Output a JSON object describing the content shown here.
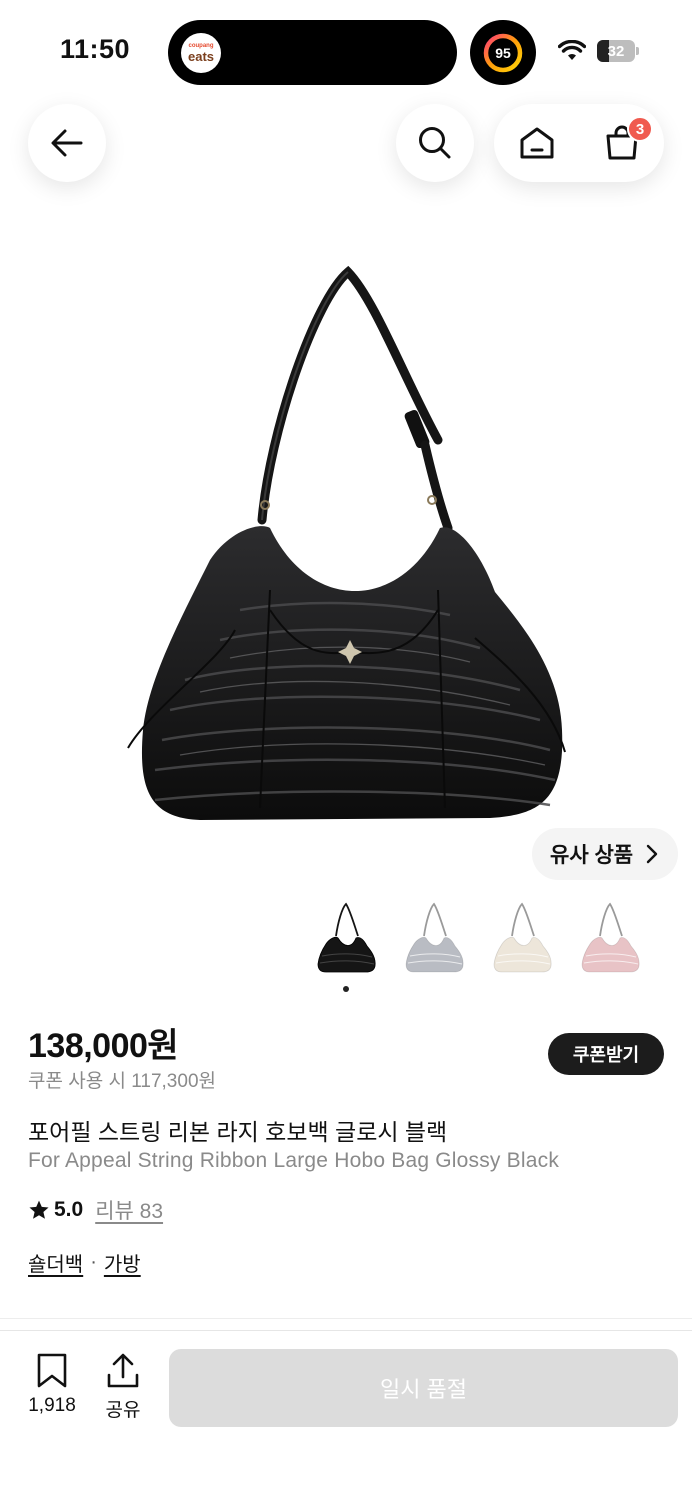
{
  "status_bar": {
    "time": "11:50",
    "live_activity_small": "coupang",
    "live_activity_big": "eats",
    "activity_ring_value": "95",
    "battery_level": 32,
    "battery_text": "32"
  },
  "nav": {
    "back_icon": "arrow-left-icon",
    "search_icon": "search-icon",
    "home_icon": "home-icon",
    "cart_icon": "shopping-bag-icon",
    "cart_count": "3"
  },
  "product": {
    "similar_button_label": "유사 상품",
    "thumbnails": [
      {
        "name": "Glossy Black",
        "color": "#151515"
      },
      {
        "name": "Silver",
        "color": "#b9bcc3"
      },
      {
        "name": "Ivory",
        "color": "#ede6da"
      },
      {
        "name": "Pink",
        "color": "#e8c3c6"
      }
    ],
    "price": "138,000원",
    "coupon_price_text": "쿠폰 사용 시 117,300원",
    "coupon_button_label": "쿠폰받기",
    "title_ko": "포어필 스트링 리본 라지 호보백 글로시 블랙",
    "title_en": "For Appeal String Ribbon Large Hobo Bag Glossy Black",
    "rating": "5.0",
    "review_label": "리뷰 83",
    "category_1": "숄더백",
    "category_separator": "·",
    "category_2": "가방"
  },
  "bottom_bar": {
    "bookmark_icon": "bookmark-icon",
    "bookmark_count": "1,918",
    "share_icon": "share-icon",
    "share_label": "공유",
    "soldout_label": "일시 품절"
  },
  "colors": {
    "badge_red": "#f05a4f",
    "dark_button": "#1c1c1c",
    "disabled_button": "#dcdcdc"
  }
}
